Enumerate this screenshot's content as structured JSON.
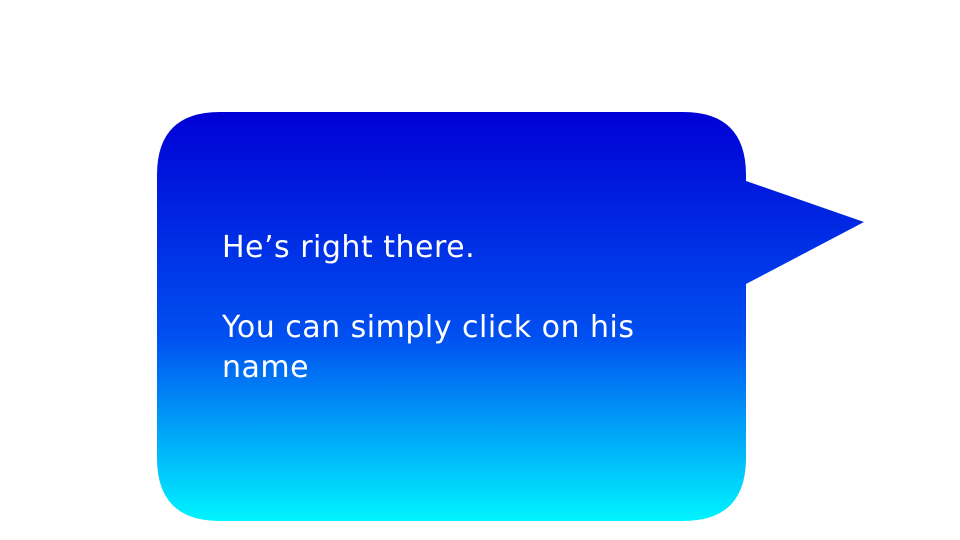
{
  "bubble": {
    "line1": "He’s right there.",
    "line2": "You can simply click on his name",
    "gradient_top": "#0000d6",
    "gradient_bottom": "#00f4ff",
    "text_color": "#ffffff"
  }
}
